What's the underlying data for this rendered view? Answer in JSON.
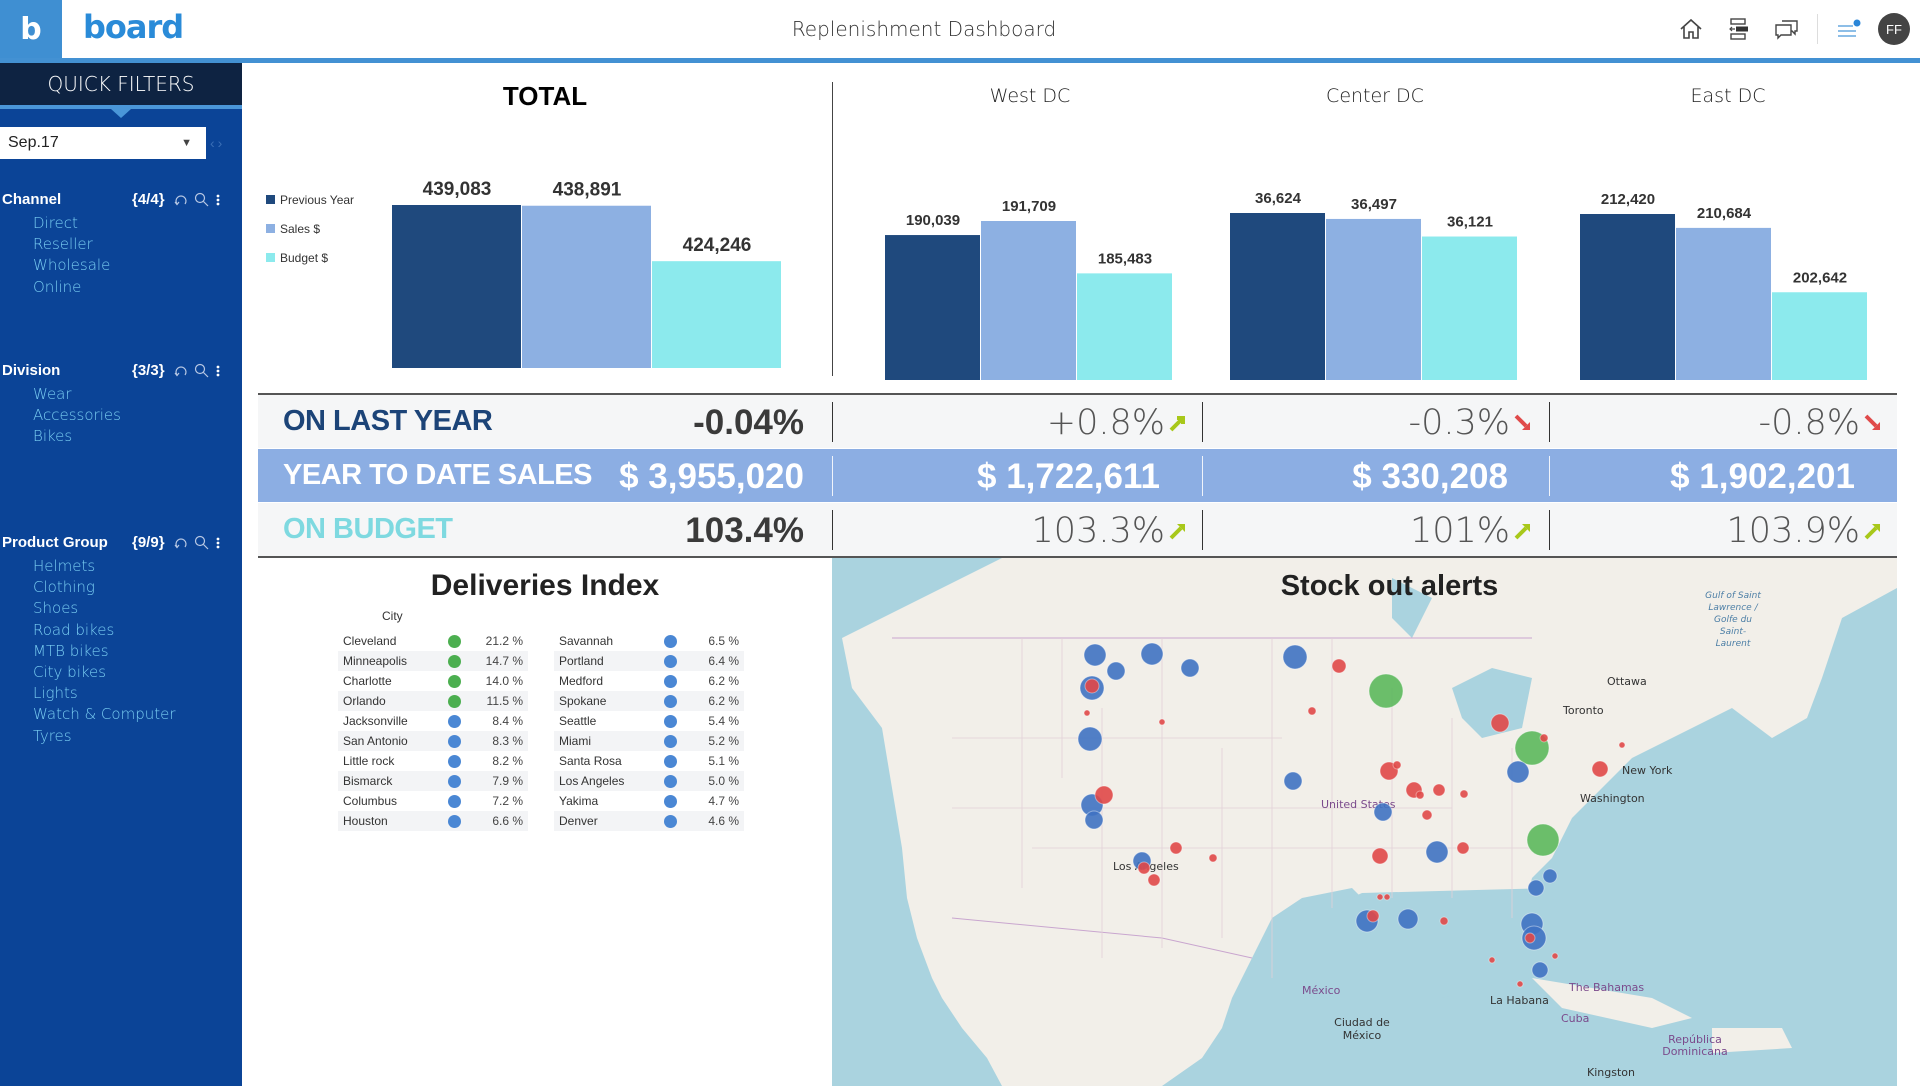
{
  "header": {
    "logo_letter": "b",
    "brand": "board",
    "title": "Replenishment Dashboard",
    "icons": [
      "home-icon",
      "layout-icon",
      "chat-icon",
      "menu-notification-icon"
    ],
    "avatar_initials": "FF"
  },
  "sidebar": {
    "title": "QUICK FILTERS",
    "date_select": {
      "value": "Sep.17",
      "prev": "‹",
      "next": "›"
    },
    "groups": [
      {
        "title": "Channel",
        "count": "{4/4}",
        "items": [
          "Direct",
          "Reseller",
          "Wholesale",
          "Online"
        ]
      },
      {
        "title": "Division",
        "count": "{3/3}",
        "items": [
          "Wear",
          "Accessories",
          "Bikes"
        ]
      },
      {
        "title": "Product Group",
        "count": "{9/9}",
        "items": [
          "Helmets",
          "Clothing",
          "Shoes",
          "Road bikes",
          "MTB bikes",
          "City bikes",
          "Lights",
          "Watch & Computer",
          "Tyres"
        ]
      }
    ]
  },
  "colors": {
    "previous_year": "#1f497d",
    "sales": "#8db0e2",
    "budget": "#8ceaed",
    "up_arrow": "#a8c81a",
    "down_arrow": "#e04a4a",
    "on_last_year_label": "#1c4478",
    "on_budget_label": "#7ed9e0",
    "green_dot": "#4caf50",
    "blue_dot": "#4a87d4"
  },
  "chart_data": [
    {
      "type": "bar",
      "title": "TOTAL",
      "categories": [
        "Previous Year",
        "Sales $",
        "Budget $"
      ],
      "values": [
        439083,
        438891,
        424246
      ],
      "labels": [
        "439,083",
        "438,891",
        "424,246"
      ],
      "legend": [
        "Previous Year",
        "Sales $",
        "Budget $"
      ],
      "legend_position": "left",
      "grid": false
    },
    {
      "type": "bar",
      "title": "West DC",
      "categories": [
        "Previous Year",
        "Sales $",
        "Budget $"
      ],
      "values": [
        190039,
        191709,
        185483
      ],
      "labels": [
        "190,039",
        "191,709",
        "185,483"
      ],
      "grid": false
    },
    {
      "type": "bar",
      "title": "Center DC",
      "categories": [
        "Previous Year",
        "Sales $",
        "Budget $"
      ],
      "values": [
        36624,
        36497,
        36121
      ],
      "labels": [
        "36,624",
        "36,497",
        "36,121"
      ],
      "grid": false
    },
    {
      "type": "bar",
      "title": "East DC",
      "categories": [
        "Previous Year",
        "Sales $",
        "Budget $"
      ],
      "values": [
        212420,
        210684,
        202642
      ],
      "labels": [
        "212,420",
        "210,684",
        "202,642"
      ],
      "grid": false
    }
  ],
  "kpis": {
    "on_last_year": {
      "label": "ON LAST YEAR",
      "total": "-0.04%",
      "west": "+0.8%",
      "center": "-0.3%",
      "east": "-0.8%",
      "trends": [
        "up",
        "down",
        "down"
      ]
    },
    "ytd_sales": {
      "label": "YEAR TO DATE SALES",
      "total": "$ 3,955,020",
      "west": "$ 1,722,611",
      "center": "$ 330,208",
      "east": "$ 1,902,201"
    },
    "on_budget": {
      "label": "ON BUDGET",
      "total": "103.4%",
      "west": "103.3%",
      "center": "101%",
      "east": "103.9%",
      "trends": [
        "up",
        "up",
        "up"
      ]
    }
  },
  "deliveries": {
    "title": "Deliveries Index",
    "column_header": "City",
    "left": [
      {
        "city": "Cleveland",
        "status": "green",
        "value": "21.2 %"
      },
      {
        "city": "Minneapolis",
        "status": "green",
        "value": "14.7 %"
      },
      {
        "city": "Charlotte",
        "status": "green",
        "value": "14.0 %"
      },
      {
        "city": "Orlando",
        "status": "green",
        "value": "11.5 %"
      },
      {
        "city": "Jacksonville",
        "status": "blue",
        "value": "8.4 %"
      },
      {
        "city": "San Antonio",
        "status": "blue",
        "value": "8.3 %"
      },
      {
        "city": "Little rock",
        "status": "blue",
        "value": "8.2 %"
      },
      {
        "city": "Bismarck",
        "status": "blue",
        "value": "7.9 %"
      },
      {
        "city": "Columbus",
        "status": "blue",
        "value": "7.2 %"
      },
      {
        "city": "Houston",
        "status": "blue",
        "value": "6.6 %"
      }
    ],
    "right": [
      {
        "city": "Savannah",
        "status": "blue",
        "value": "6.5 %"
      },
      {
        "city": "Portland",
        "status": "blue",
        "value": "6.4 %"
      },
      {
        "city": "Medford",
        "status": "blue",
        "value": "6.2 %"
      },
      {
        "city": "Spokane",
        "status": "blue",
        "value": "6.2 %"
      },
      {
        "city": "Seattle",
        "status": "blue",
        "value": "5.4 %"
      },
      {
        "city": "Miami",
        "status": "blue",
        "value": "5.2 %"
      },
      {
        "city": "Santa Rosa",
        "status": "blue",
        "value": "5.1 %"
      },
      {
        "city": "Los Angeles",
        "status": "blue",
        "value": "5.0 %"
      },
      {
        "city": "Yakima",
        "status": "blue",
        "value": "4.7 %"
      },
      {
        "city": "Denver",
        "status": "blue",
        "value": "4.6 %"
      }
    ]
  },
  "map": {
    "title": "Stock out alerts",
    "labels": {
      "ottawa": "Ottawa",
      "toronto": "Toronto",
      "new_york": "New York",
      "washington": "Washington",
      "united_states": "United States",
      "los_angeles": "Los Angeles",
      "mexico": "México",
      "mexico_city": "Ciudad de México",
      "havana": "La Habana",
      "cuba": "Cuba",
      "bahamas": "The Bahamas",
      "dominican_republic": "República Dominicana",
      "kingston": "Kingston",
      "gulf_st_lawrence": "Gulf of Saint Lawrence / Golfe du Saint-Laurent"
    },
    "legend_statuses": [
      "green",
      "blue",
      "red"
    ]
  }
}
